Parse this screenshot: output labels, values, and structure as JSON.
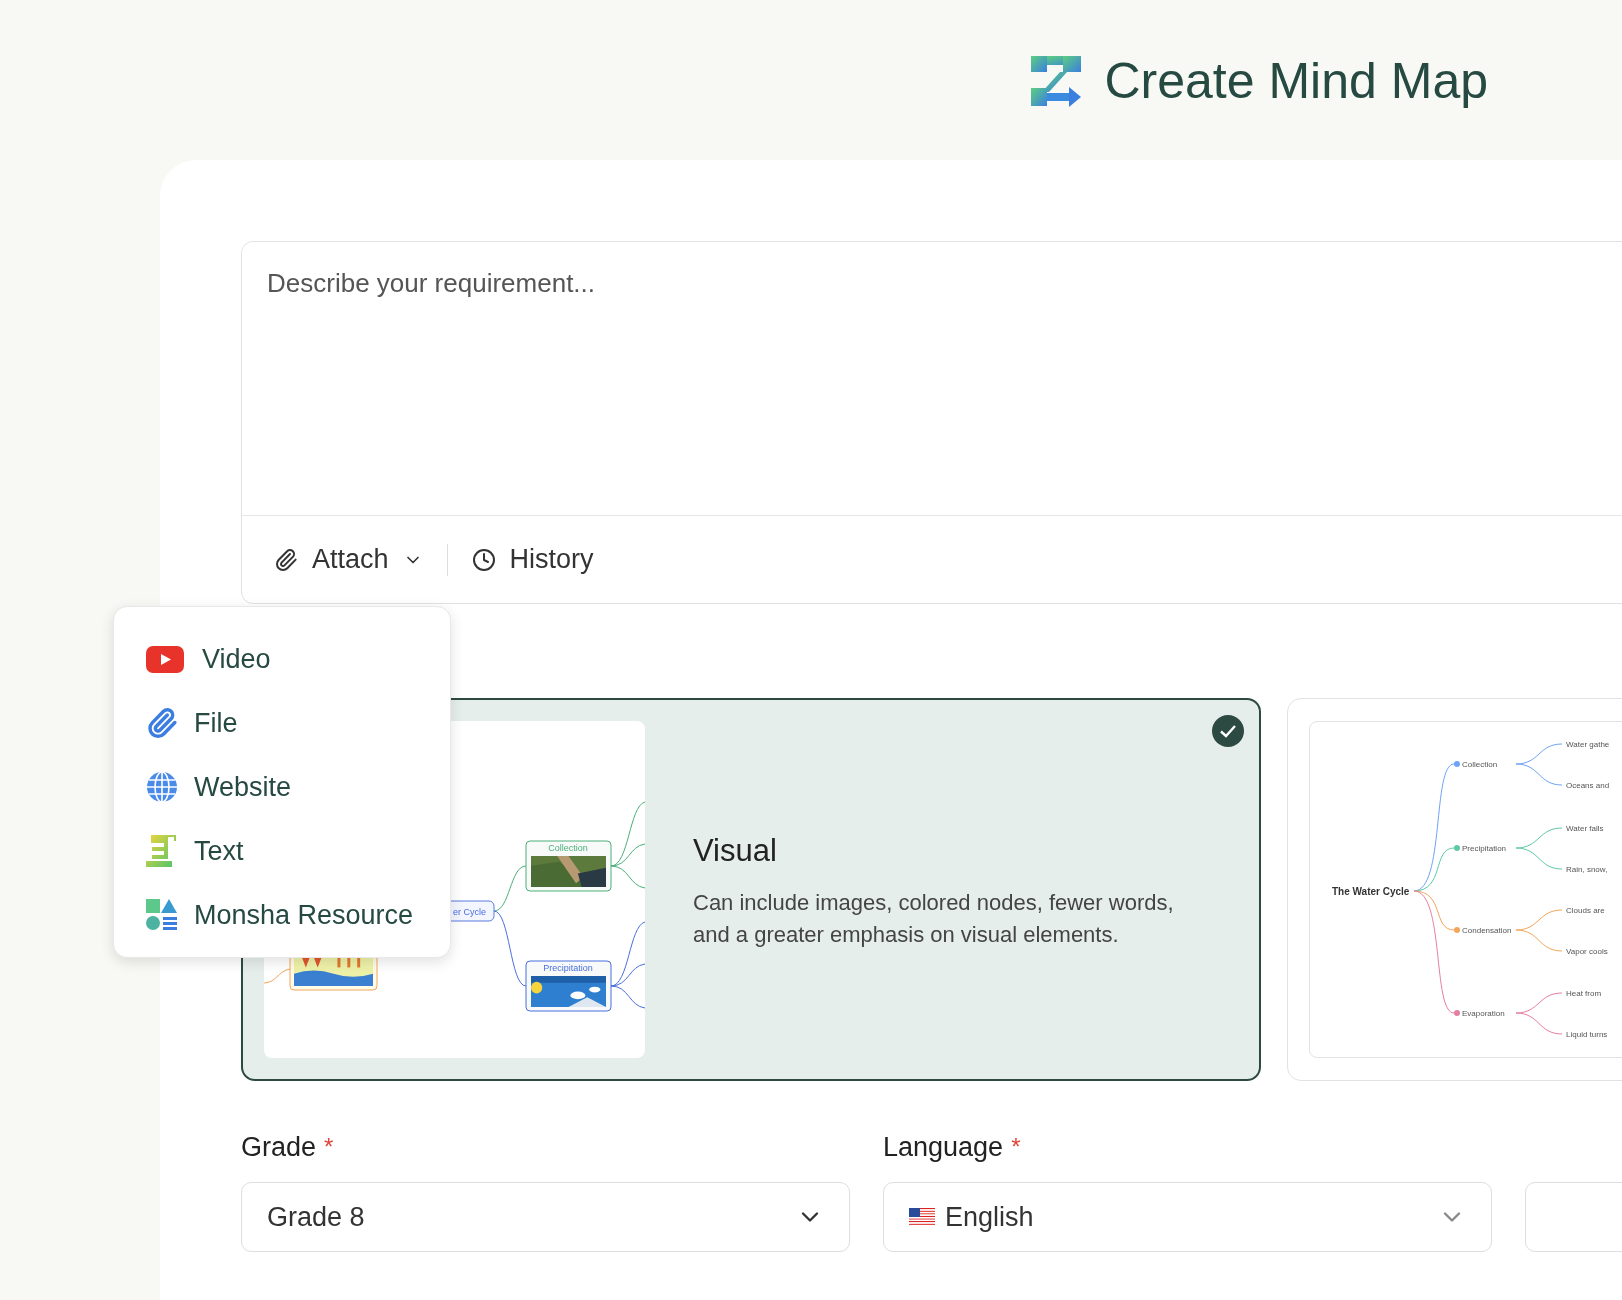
{
  "header": {
    "title": "Create Mind Map"
  },
  "prompt": {
    "placeholder": "Describe your requirement...",
    "toolbar": [
      {
        "label": "Attach",
        "kind": "dropdown"
      },
      {
        "label": "History",
        "kind": "history"
      }
    ]
  },
  "attach_menu": {
    "items": [
      {
        "label": "Video",
        "kind": "video"
      },
      {
        "label": "File",
        "kind": "file"
      },
      {
        "label": "Website",
        "kind": "website"
      },
      {
        "label": "Text",
        "kind": "text"
      },
      {
        "label": "Monsha Resource",
        "kind": "resource"
      }
    ]
  },
  "styles": [
    {
      "title": "Visual",
      "description": "Can include images, colored nodes, fewer words, and a greater emphasis on visual elements.",
      "selected": true,
      "preview": {
        "kind": "visual",
        "root": "er Cycle",
        "branches": [
          {
            "label": "Collection",
            "color": "#4caf7a"
          },
          {
            "label": "Precipitation",
            "color": "#4a6ee0"
          }
        ]
      }
    },
    {
      "selected": false,
      "preview": {
        "kind": "outline",
        "root": "The Water Cycle",
        "branches": [
          {
            "label": "Collection",
            "color": "#6fa3f5",
            "children": [
              "Water gathe",
              "Oceans and"
            ]
          },
          {
            "label": "Precipitation",
            "color": "#5ec9a8",
            "children": [
              "Water falls",
              "Rain, snow,"
            ]
          },
          {
            "label": "Condensation",
            "color": "#f2a65a",
            "children": [
              "Clouds are",
              "Vapor cools"
            ]
          },
          {
            "label": "Evaporation",
            "color": "#e57fa0",
            "children": [
              "Heat from",
              "Liquid turns"
            ]
          }
        ]
      }
    }
  ],
  "fields": [
    {
      "kind": "select",
      "label": "Grade",
      "required_mark": "*",
      "value": "Grade 8"
    },
    {
      "kind": "language",
      "label": "Language",
      "required_mark": "*",
      "value": "English"
    },
    {
      "kind": "select"
    }
  ]
}
